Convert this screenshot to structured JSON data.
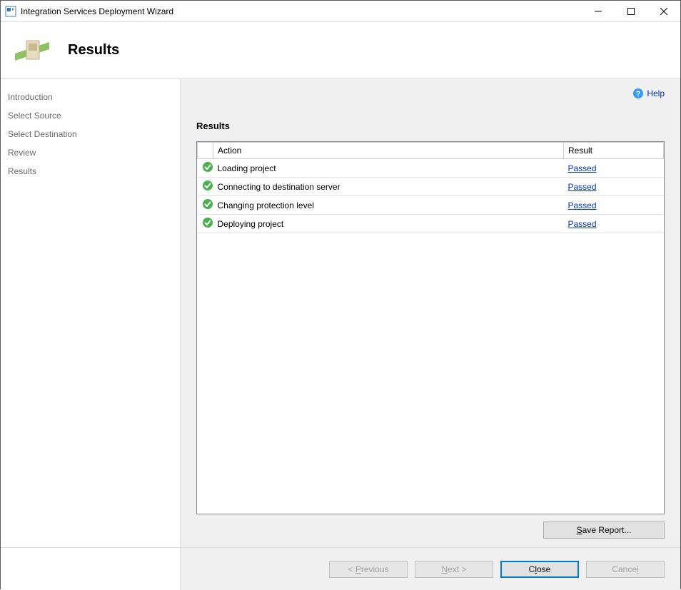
{
  "window": {
    "title": "Integration Services Deployment Wizard"
  },
  "header": {
    "title": "Results"
  },
  "sidebar": {
    "items": [
      {
        "label": "Introduction"
      },
      {
        "label": "Select Source"
      },
      {
        "label": "Select Destination"
      },
      {
        "label": "Review"
      },
      {
        "label": "Results"
      }
    ]
  },
  "help": {
    "label": "Help"
  },
  "content": {
    "section_title": "Results",
    "columns": {
      "action": "Action",
      "result": "Result"
    },
    "rows": [
      {
        "action": "Loading project",
        "result": "Passed"
      },
      {
        "action": "Connecting to destination server",
        "result": "Passed"
      },
      {
        "action": "Changing protection level",
        "result": "Passed"
      },
      {
        "action": "Deploying project",
        "result": "Passed"
      }
    ]
  },
  "buttons": {
    "save_report": "Save Report...",
    "previous": "< Previous",
    "next": "Next >",
    "close": "Close",
    "cancel": "Cancel"
  }
}
